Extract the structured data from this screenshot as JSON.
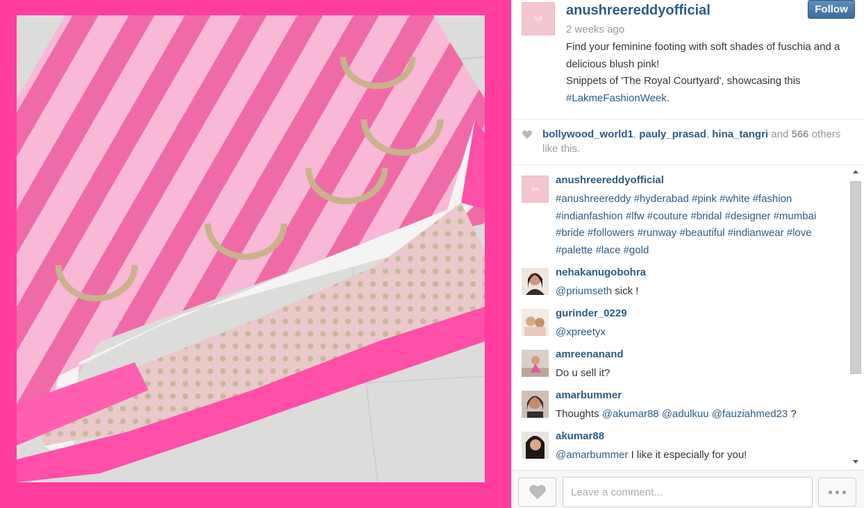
{
  "post": {
    "username": "anushreereddyofficial",
    "time_ago": "2 weeks ago",
    "follow_label": "Follow",
    "brand_avatar_text": "AR",
    "caption_line1": "Find your feminine footing with soft shades of fuschia and a delicious blush pink!",
    "caption_line2_prefix": "Snippets of 'The Royal Courtyard', showcasing this ",
    "caption_hashtag": "#LakmeFashionWeek",
    "caption_line2_suffix": "."
  },
  "likes": {
    "users": [
      "bollywood_world1",
      "pauly_prasad",
      "hina_tangri"
    ],
    "sep": ", ",
    "and": " and ",
    "count": "566",
    "suffix": " others like this."
  },
  "comments": [
    {
      "user": "anushreereddyofficial",
      "tags": [
        "#anushreereddy",
        "#hyderabad",
        "#pink",
        "#white",
        "#fashion",
        "#indianfashion",
        "#lfw",
        "#couture",
        "#bridal",
        "#designer",
        "#mumbai",
        "#bride",
        "#followers",
        "#runway",
        "#beautiful",
        "#indianwear",
        "#love",
        "#palette",
        "#lace",
        "#gold"
      ]
    },
    {
      "user": "nehakanugobohra",
      "mention": "@priumseth",
      "text": " sick !"
    },
    {
      "user": "gurinder_0229",
      "mention": "@xpreetyx",
      "text": ""
    },
    {
      "user": "amreenanand",
      "mention": "",
      "text": "Do u sell it?"
    },
    {
      "user": "amarbummer",
      "text_prefix": "Thoughts ",
      "mentions": [
        "@akumar88",
        "@adulkuu",
        "@fauziahmed23"
      ],
      "text_suffix": " ?"
    },
    {
      "user": "akumar88",
      "mention": "@amarbummer",
      "text": " I like it especially for you!"
    }
  ],
  "footer": {
    "comment_placeholder": "Leave a comment..."
  },
  "colors": {
    "frame_pink": "#ff3d9e",
    "link_blue": "#2b5c85",
    "follow_button": "#4a7aa6"
  },
  "icons": {
    "like": "heart-icon",
    "more": "ellipsis-icon",
    "scroll_up": "arrow-up-icon",
    "scroll_down": "arrow-down-icon"
  }
}
